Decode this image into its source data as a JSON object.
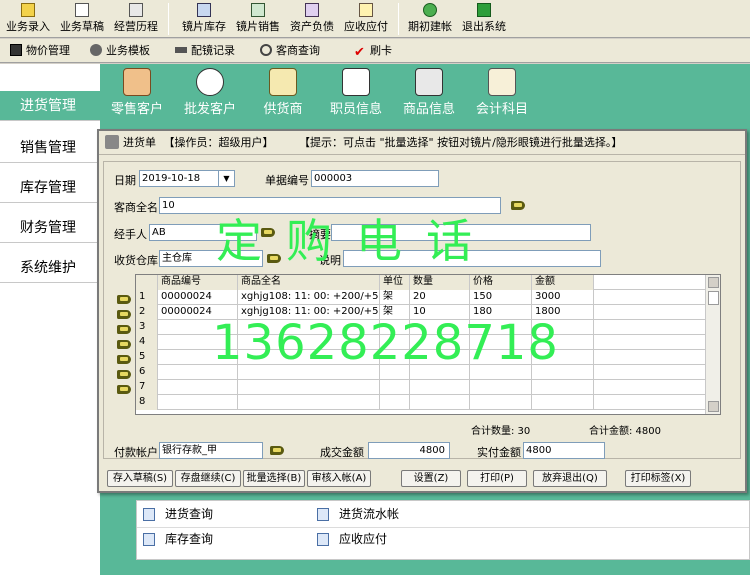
{
  "toolbar": {
    "buttons": [
      {
        "label": "业务录入",
        "icon": "entry-icon"
      },
      {
        "label": "业务草稿",
        "icon": "draft-icon"
      },
      {
        "label": "经营历程",
        "icon": "history-icon"
      },
      {
        "label": "镜片库存",
        "icon": "lens-stock-icon"
      },
      {
        "label": "镜片销售",
        "icon": "lens-sales-icon"
      },
      {
        "label": "资产负债",
        "icon": "balance-icon"
      },
      {
        "label": "应收应付",
        "icon": "receivable-icon"
      },
      {
        "label": "期初建帐",
        "icon": "init-account-icon"
      },
      {
        "label": "退出系统",
        "icon": "exit-icon"
      }
    ]
  },
  "toolbar2": {
    "buttons": [
      {
        "label": "物价管理",
        "icon": "price-icon"
      },
      {
        "label": "业务模板",
        "icon": "template-icon"
      },
      {
        "label": "配镜记录",
        "icon": "glasses-icon"
      },
      {
        "label": "客商查询",
        "icon": "query-icon"
      },
      {
        "label": "刷卡",
        "icon": "check-icon"
      }
    ]
  },
  "leftnav": {
    "items": [
      {
        "label": "进货管理"
      },
      {
        "label": "销售管理"
      },
      {
        "label": "库存管理"
      },
      {
        "label": "财务管理"
      },
      {
        "label": "系统维护"
      }
    ]
  },
  "iconband": {
    "items": [
      {
        "label": "零售客户",
        "icon": "retail-customer-icon"
      },
      {
        "label": "批发客户",
        "icon": "wholesale-customer-icon"
      },
      {
        "label": "供货商",
        "icon": "supplier-icon"
      },
      {
        "label": "职员信息",
        "icon": "staff-icon"
      },
      {
        "label": "商品信息",
        "icon": "product-icon"
      },
      {
        "label": "会计科目",
        "icon": "account-icon"
      }
    ]
  },
  "lower_panel": {
    "items": [
      "进货查询",
      "进货流水帐",
      "库存查询",
      "应收应付"
    ]
  },
  "dialog": {
    "title": "进货单",
    "operator": "【操作员：超级用户】",
    "hint": "【提示：可点击 \"批量选择\" 按钮对镜片/隐形眼镜进行批量选择。】",
    "date_label": "日期",
    "date_value": "2019-10-18",
    "doc_no_label": "单据编号",
    "doc_no_value": "000003",
    "supplier_label": "客商全名",
    "supplier_value": "10",
    "handler_label": "经手人",
    "handler_value": "AB",
    "summary_label": "摘要",
    "summary_value": "",
    "warehouse_label": "收货仓库",
    "warehouse_value": "主仓库",
    "note_label": "说明",
    "note_value": "",
    "grid": {
      "headers": [
        "",
        "商品编号",
        "商品全名",
        "单位",
        "数量",
        "价格",
        "金额"
      ],
      "rows": [
        [
          "1",
          "00000024",
          "xghjg108: 11: 00: +200/+50",
          "架",
          "20",
          "150",
          "3000"
        ],
        [
          "2",
          "00000024",
          "xghjg108: 11: 00: +200/+50",
          "架",
          "10",
          "180",
          "1800"
        ],
        [
          "3",
          "",
          "",
          "",
          "",
          "",
          ""
        ],
        [
          "4",
          "",
          "",
          "",
          "",
          "",
          ""
        ],
        [
          "5",
          "",
          "",
          "",
          "",
          "",
          ""
        ],
        [
          "6",
          "",
          "",
          "",
          "",
          "",
          ""
        ],
        [
          "7",
          "",
          "",
          "",
          "",
          "",
          ""
        ],
        [
          "8",
          "",
          "",
          "",
          "",
          "",
          ""
        ]
      ]
    },
    "total_qty": "合计数量: 30",
    "total_amount": "合计金额: 4800",
    "pay_account_label": "付款帐户",
    "pay_account_value": "银行存款_甲",
    "deal_amount_label": "成交金额",
    "deal_amount_value": "4800",
    "paid_amount_label": "实付金额",
    "paid_amount_value": "4800",
    "buttons": [
      "存入草稿(S)",
      "存盘继续(C)",
      "批量选择(B)",
      "审核入帐(A)",
      "设置(Z)",
      "打印(P)",
      "放弃退出(Q)",
      "打印标签(X)"
    ]
  },
  "watermark": {
    "line1": "定购电话",
    "line2": "13628228718"
  }
}
